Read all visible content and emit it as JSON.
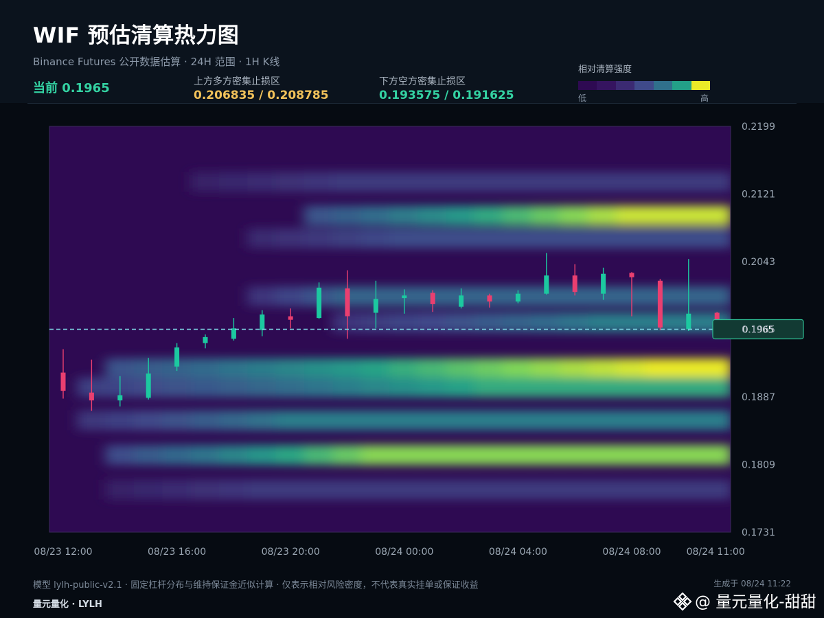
{
  "header": {
    "title": "WIF 预估清算热力图",
    "subtitle": "Binance Futures 公开数据估算 · 24H 范围 · 1H K线",
    "current_label": "当前 0.1965",
    "upper_zone_label": "上方多方密集止损区",
    "upper_zone_value": "0.206835 / 0.208785",
    "lower_zone_label": "下方空方密集止损区",
    "lower_zone_value": "0.193575 / 0.191625"
  },
  "legend": {
    "title": "相对清算强度",
    "low": "低",
    "high": "高",
    "colors": [
      "#2e0a52",
      "#35145f",
      "#3b2a72",
      "#3f4a8a",
      "#30708c",
      "#23a088",
      "#eaea28"
    ]
  },
  "chart_data": {
    "type": "heatmap",
    "title": "WIF 预估清算热力图",
    "x_tick_labels": [
      "08/23 12:00",
      "08/23 16:00",
      "08/23 20:00",
      "08/24 00:00",
      "08/24 04:00",
      "08/24 08:00",
      "08/24 11:00"
    ],
    "y_tick_labels": [
      "0.2199",
      "0.2121",
      "0.2043",
      "0.1965",
      "0.1887",
      "0.1809",
      "0.1731"
    ],
    "ylim": [
      0.1731,
      0.2199
    ],
    "current_price": 0.1965,
    "current_price_label": "0.1965",
    "color_scale": [
      "#2e0a52",
      "#3b2a72",
      "#3f4a8a",
      "#30708c",
      "#23a088",
      "#7cd45a",
      "#eaea28"
    ],
    "heat_bands": [
      {
        "price": 0.2096,
        "intensity": 0.95,
        "start_hour": 9,
        "ramp_hours": 12
      },
      {
        "price": 0.207,
        "intensity": 0.35,
        "start_hour": 7,
        "ramp_hours": 6
      },
      {
        "price": 0.2003,
        "intensity": 0.45,
        "start_hour": 7,
        "ramp_hours": 4
      },
      {
        "price": 0.1973,
        "intensity": 0.55,
        "start_hour": 10,
        "ramp_hours": 10
      },
      {
        "price": 0.192,
        "intensity": 1.0,
        "start_hour": 2,
        "ramp_hours": 20
      },
      {
        "price": 0.1898,
        "intensity": 0.7,
        "start_hour": 1,
        "ramp_hours": 15
      },
      {
        "price": 0.186,
        "intensity": 0.55,
        "start_hour": 1,
        "ramp_hours": 8
      },
      {
        "price": 0.182,
        "intensity": 0.85,
        "start_hour": 2,
        "ramp_hours": 10
      },
      {
        "price": 0.2135,
        "intensity": 0.25,
        "start_hour": 5,
        "ramp_hours": 6
      },
      {
        "price": 0.178,
        "intensity": 0.25,
        "start_hour": 2,
        "ramp_hours": 6
      }
    ],
    "candles": [
      {
        "time": "08/23 12:00",
        "open": 0.1915,
        "high": 0.1942,
        "low": 0.1885,
        "close": 0.1894
      },
      {
        "time": "08/23 13:00",
        "open": 0.1892,
        "high": 0.193,
        "low": 0.1871,
        "close": 0.1883
      },
      {
        "time": "08/23 14:00",
        "open": 0.1883,
        "high": 0.1911,
        "low": 0.1876,
        "close": 0.1889
      },
      {
        "time": "08/23 15:00",
        "open": 0.1886,
        "high": 0.1932,
        "low": 0.1884,
        "close": 0.1914
      },
      {
        "time": "08/23 16:00",
        "open": 0.1922,
        "high": 0.1949,
        "low": 0.1917,
        "close": 0.1944
      },
      {
        "time": "08/23 17:00",
        "open": 0.1949,
        "high": 0.1959,
        "low": 0.1943,
        "close": 0.1956
      },
      {
        "time": "08/23 18:00",
        "open": 0.1954,
        "high": 0.1978,
        "low": 0.1952,
        "close": 0.1966
      },
      {
        "time": "08/23 19:00",
        "open": 0.1964,
        "high": 0.1987,
        "low": 0.1957,
        "close": 0.1982
      },
      {
        "time": "08/23 20:00",
        "open": 0.198,
        "high": 0.1989,
        "low": 0.1966,
        "close": 0.1976
      },
      {
        "time": "08/23 21:00",
        "open": 0.1978,
        "high": 0.2019,
        "low": 0.1977,
        "close": 0.2013
      },
      {
        "time": "08/23 22:00",
        "open": 0.2012,
        "high": 0.2033,
        "low": 0.1954,
        "close": 0.198
      },
      {
        "time": "08/23 23:00",
        "open": 0.1984,
        "high": 0.2021,
        "low": 0.1966,
        "close": 0.2
      },
      {
        "time": "08/24 00:00",
        "open": 0.2001,
        "high": 0.2011,
        "low": 0.1983,
        "close": 0.2004
      },
      {
        "time": "08/24 01:00",
        "open": 0.2007,
        "high": 0.201,
        "low": 0.1985,
        "close": 0.1994
      },
      {
        "time": "08/24 02:00",
        "open": 0.1991,
        "high": 0.2012,
        "low": 0.1989,
        "close": 0.2004
      },
      {
        "time": "08/24 03:00",
        "open": 0.2004,
        "high": 0.2006,
        "low": 0.199,
        "close": 0.1997
      },
      {
        "time": "08/24 04:00",
        "open": 0.1997,
        "high": 0.201,
        "low": 0.1995,
        "close": 0.2006
      },
      {
        "time": "08/24 05:00",
        "open": 0.2006,
        "high": 0.2053,
        "low": 0.2005,
        "close": 0.2027
      },
      {
        "time": "08/24 06:00",
        "open": 0.2027,
        "high": 0.204,
        "low": 0.2004,
        "close": 0.2008
      },
      {
        "time": "08/24 07:00",
        "open": 0.2006,
        "high": 0.2036,
        "low": 0.1999,
        "close": 0.2029
      },
      {
        "time": "08/24 08:00",
        "open": 0.203,
        "high": 0.2031,
        "low": 0.198,
        "close": 0.2025
      },
      {
        "time": "08/24 09:00",
        "open": 0.2021,
        "high": 0.2023,
        "low": 0.1964,
        "close": 0.1967
      },
      {
        "time": "08/24 10:00",
        "open": 0.1965,
        "high": 0.2046,
        "low": 0.1963,
        "close": 0.1983
      },
      {
        "time": "08/24 11:00",
        "open": 0.1984,
        "high": 0.1985,
        "low": 0.1973,
        "close": 0.1976
      }
    ]
  },
  "footer": {
    "note": "模型 lylh-public-v2.1 · 固定杠杆分布与维持保证金近似计算 · 仅表示相对风险密度，不代表真实挂单或保证收益",
    "brand": "量元量化 · LYLH",
    "generated": "生成于 08/24 11:22",
    "watermark": "@ 量元量化-甜甜"
  },
  "colors": {
    "up_candle": "#1cc9a0",
    "down_candle": "#ea3f70",
    "price_line": "#7fd8e6",
    "price_tag_bg": "#123a33",
    "price_tag_border": "#2ebd93",
    "axis_text": "#9aa6b2"
  }
}
